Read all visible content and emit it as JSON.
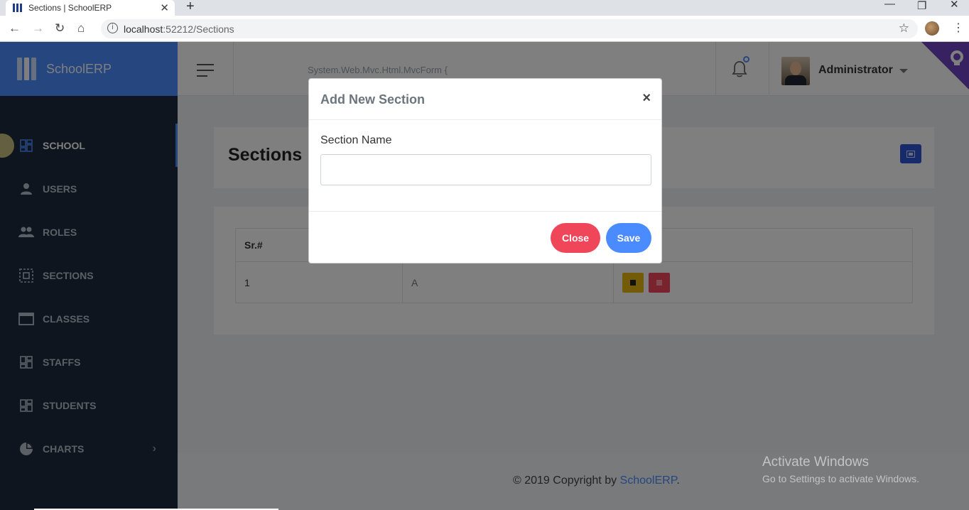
{
  "browser": {
    "tab_title": "Sections | SchoolERP",
    "url_host": "localhost",
    "url_rest": ":52212/Sections"
  },
  "app": {
    "brand": "SchoolERP",
    "leaked_text": "System.Web.Mvc.Html.MvcForm {",
    "user_name": "Administrator",
    "accent_color": "#4a8cff"
  },
  "sidebar": {
    "items": [
      {
        "label": "SCHOOL",
        "icon": "dashboard-icon",
        "active": true
      },
      {
        "label": "USERS",
        "icon": "person-icon"
      },
      {
        "label": "ROLES",
        "icon": "people-icon"
      },
      {
        "label": "SECTIONS",
        "icon": "select-all-icon"
      },
      {
        "label": "CLASSES",
        "icon": "window-icon"
      },
      {
        "label": "STAFFS",
        "icon": "dashboard-icon"
      },
      {
        "label": "STUDENTS",
        "icon": "dashboard-icon"
      },
      {
        "label": "CHARTS",
        "icon": "pie-chart-icon",
        "has_submenu": true
      }
    ]
  },
  "page": {
    "title": "Sections",
    "table": {
      "headers": [
        "Sr.#",
        "",
        ""
      ],
      "rows": [
        {
          "sr": "1",
          "name": "A"
        }
      ]
    }
  },
  "modal": {
    "title": "Add New Section",
    "close_glyph": "×",
    "field_label": "Section Name",
    "field_value": "",
    "close_label": "Close",
    "save_label": "Save"
  },
  "footer": {
    "prefix": "© 2019 Copyright by ",
    "brand": "SchoolERP",
    "suffix": "."
  },
  "watermark": {
    "line1": "Activate Windows",
    "line2": "Go to Settings to activate Windows."
  }
}
